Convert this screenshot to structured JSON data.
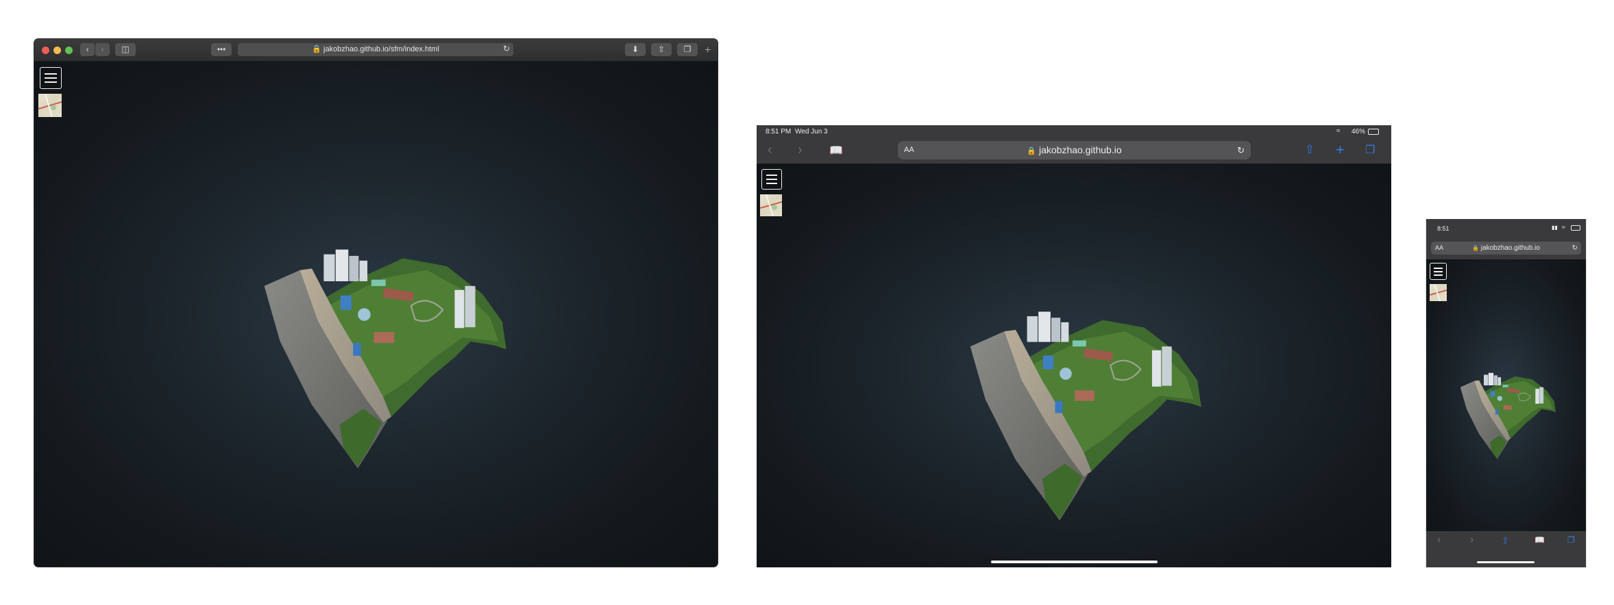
{
  "desktop": {
    "url": "jakobzhao.github.io/sfm/index.html",
    "toolbar_icons": [
      "close-dot",
      "minimize-dot",
      "zoom-dot",
      "back-icon",
      "forward-icon",
      "sidebar-icon",
      "more-icon",
      "reload-icon",
      "download-icon",
      "share-icon",
      "tabs-icon",
      "new-tab-icon"
    ],
    "menu_icon": "hamburger-icon",
    "basemap_icon": "basemap-thumbnail"
  },
  "ipad": {
    "time": "8:51 PM",
    "date": "Wed Jun 3",
    "battery": "46%",
    "reader_label": "AA",
    "url": "jakobzhao.github.io",
    "nav_icons": [
      "back-icon",
      "forward-icon",
      "bookmarks-icon",
      "share-icon",
      "add-icon",
      "tabs-icon"
    ]
  },
  "iphone": {
    "time": "8:51",
    "reader_label": "AA",
    "url": "jakobzhao.github.io",
    "bottom_icons": [
      "back-icon",
      "forward-icon",
      "share-icon",
      "bookmarks-icon",
      "tabs-icon"
    ]
  },
  "colors": {
    "background": "#15191c",
    "accent_blue": "#2f7de1",
    "chrome_dark": "#3a3a3c"
  }
}
